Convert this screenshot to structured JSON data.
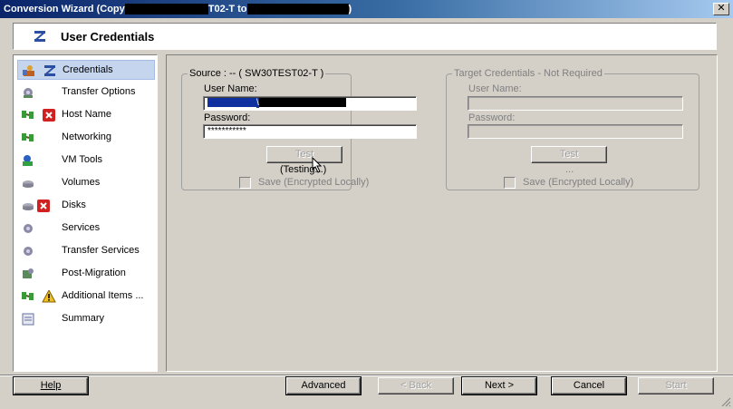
{
  "window": {
    "title_prefix": "Conversion Wizard (Copy ",
    "title_mid1": "T02-T to ",
    "title_suffix": ")",
    "close_glyph": "✕"
  },
  "header": {
    "title": "User Credentials",
    "icon": "wizard-icon"
  },
  "sidebar": {
    "items": [
      {
        "label": "Credentials",
        "icons": [
          "lock-user-icon",
          "wizard-icon"
        ]
      },
      {
        "label": "Transfer Options",
        "icons": [
          "gear-icon"
        ]
      },
      {
        "label": "Host Name",
        "icons": [
          "network-icon",
          "error-icon"
        ]
      },
      {
        "label": "Networking",
        "icons": [
          "network-icon"
        ]
      },
      {
        "label": "VM Tools",
        "icons": [
          "vm-tools-icon"
        ]
      },
      {
        "label": "Volumes",
        "icons": [
          "disk-icon"
        ]
      },
      {
        "label": "Disks",
        "icons": [
          "disk-icon",
          "error-icon"
        ]
      },
      {
        "label": "Services",
        "icons": [
          "gear-icon"
        ]
      },
      {
        "label": "Transfer Services",
        "icons": [
          "gear-icon"
        ]
      },
      {
        "label": "Post-Migration",
        "icons": [
          "script-icon"
        ]
      },
      {
        "label": "Additional Items ...",
        "icons": [
          "network-icon",
          "warning-icon"
        ]
      },
      {
        "label": "Summary",
        "icons": [
          "summary-icon"
        ]
      }
    ],
    "selected": 0
  },
  "source": {
    "title": "Source : -- ( SW30TEST02-T )",
    "username_label": "User Name:",
    "username_value": "\\",
    "password_label": "Password:",
    "password_value": "***********",
    "test_label": "Test",
    "status": "(Testing...)",
    "save_label": "Save (Encrypted Locally)"
  },
  "target": {
    "title": "Target Credentials - Not Required",
    "username_label": "User Name:",
    "password_label": "Password:",
    "test_label": "Test",
    "status": "...",
    "save_label": "Save (Encrypted Locally)"
  },
  "buttons": {
    "help": "Help",
    "advanced": "Advanced",
    "back": "< Back",
    "next": "Next >",
    "cancel": "Cancel",
    "start": "Start"
  }
}
